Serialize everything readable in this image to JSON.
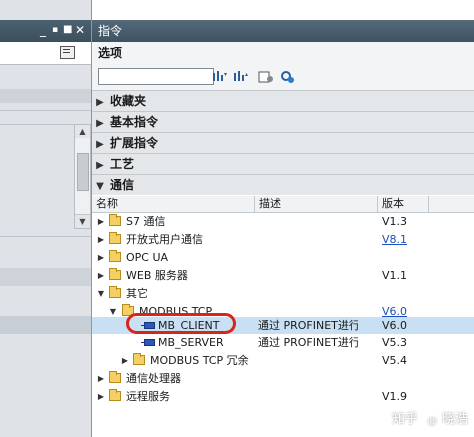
{
  "left_panel": {
    "window_controls": [
      "_",
      "▪",
      "■",
      "✕"
    ]
  },
  "card": {
    "title": "指令",
    "options_label": "选项",
    "search": {
      "value": "",
      "placeholder": ""
    }
  },
  "icons": [
    "find-down-icon",
    "find-up-icon",
    "options-icon",
    "update-icon"
  ],
  "sections": [
    {
      "label": "收藏夹",
      "expanded": false
    },
    {
      "label": "基本指令",
      "expanded": false
    },
    {
      "label": "扩展指令",
      "expanded": false
    },
    {
      "label": "工艺",
      "expanded": false
    },
    {
      "label": "通信",
      "expanded": true
    }
  ],
  "columns": {
    "name": "名称",
    "description": "描述",
    "version": "版本"
  },
  "tree": [
    {
      "name": "S7 通信",
      "desc": "",
      "ver": "V1.3",
      "link": false
    },
    {
      "name": "开放式用户通信",
      "desc": "",
      "ver": "V8.1",
      "link": true
    },
    {
      "name": "OPC UA",
      "desc": "",
      "ver": "",
      "link": false
    },
    {
      "name": "WEB 服务器",
      "desc": "",
      "ver": "V1.1",
      "link": false
    },
    {
      "name": "其它",
      "desc": "",
      "ver": "",
      "link": false
    },
    {
      "name": "MODBUS TCP",
      "desc": "",
      "ver": "V6.0",
      "link": true
    },
    {
      "name": "MB_CLIENT",
      "desc": "通过 PROFINET进行...",
      "ver": "V6.0",
      "link": false
    },
    {
      "name": "MB_SERVER",
      "desc": "通过 PROFINET进行...",
      "ver": "V5.3",
      "link": false
    },
    {
      "name": "MODBUS TCP 冗余",
      "desc": "",
      "ver": "V5.4",
      "link": false
    },
    {
      "name": "通信处理器",
      "desc": "",
      "ver": "",
      "link": false
    },
    {
      "name": "远程服务",
      "desc": "",
      "ver": "V1.9",
      "link": false
    }
  ],
  "watermark": {
    "prefix": "知乎",
    "symbol": "@",
    "author": "晓浩"
  },
  "colors": {
    "accent": "#d6261c",
    "link": "#1a4fc2",
    "title_bar": "#4a5f6e"
  }
}
